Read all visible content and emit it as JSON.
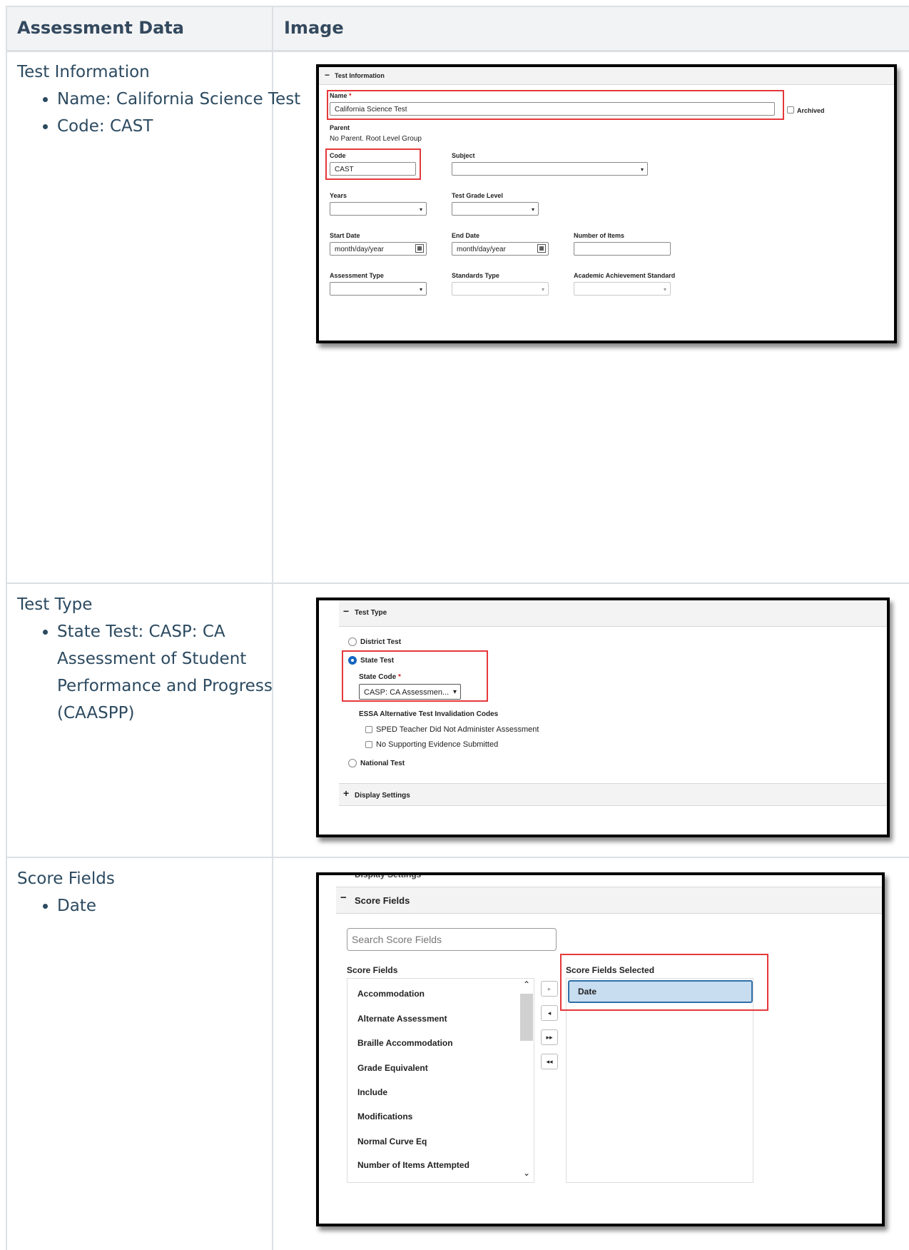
{
  "table": {
    "headers": [
      "Assessment Data",
      "Image"
    ]
  },
  "rows": {
    "test_information": {
      "title": "Test Information",
      "bullets": [
        "Name: California Science Test",
        "Code: CAST"
      ]
    },
    "test_type": {
      "title": "Test Type",
      "bullets": [
        "State Test: CASP: CA Assessment of Student Performance and Progress (CAASPP)"
      ]
    },
    "score_fields": {
      "title": "Score Fields",
      "bullets": [
        "Date"
      ]
    }
  },
  "shot1": {
    "section": "Test Information",
    "collapse_glyph": "−",
    "name_label": "Name",
    "required_mark": "*",
    "name_value": "California Science Test",
    "archived_label": "Archived",
    "parent_label": "Parent",
    "parent_value": "No Parent. Root Level Group",
    "code_label": "Code",
    "code_value": "CAST",
    "subject_label": "Subject",
    "years_label": "Years",
    "grade_label": "Test Grade Level",
    "start_label": "Start Date",
    "start_placeholder": "month/day/year",
    "end_label": "End Date",
    "end_placeholder": "month/day/year",
    "items_label": "Number of Items",
    "assessment_type_label": "Assessment Type",
    "standards_type_label": "Standards Type",
    "academic_label": "Academic Achievement Standard",
    "dropdown_caret": "▾",
    "calendar_glyph": "▦"
  },
  "shot2": {
    "section": "Test Type",
    "collapse_glyph": "−",
    "district": "District Test",
    "state": "State Test",
    "state_code_label": "State Code",
    "required_mark": "*",
    "state_code_value": "CASP: CA Assessmen...",
    "dropdown_caret": "▾",
    "essa_label": "ESSA Alternative Test Invalidation Codes",
    "essa_options": [
      "SPED Teacher Did Not Administer Assessment",
      "No Supporting Evidence Submitted"
    ],
    "national": "National Test",
    "expand_glyph": "+",
    "display_settings": "Display Settings"
  },
  "shot3": {
    "cut_header": "Display Settings",
    "section": "Score Fields",
    "collapse_glyph": "−",
    "search_placeholder": "Search Score Fields",
    "available_label": "Score Fields",
    "selected_label": "Score Fields Selected",
    "available": [
      "Accommodation",
      "Alternate Assessment",
      "Braille Accommodation",
      "Grade Equivalent",
      "Include",
      "Modifications",
      "Normal Curve Eq",
      "Number of Items Attempted"
    ],
    "selected": [
      "Date"
    ],
    "buttons": [
      "▸",
      "◂",
      "▸▸",
      "◂◂"
    ],
    "scroll_up": "⌃",
    "scroll_down": "⌄"
  }
}
